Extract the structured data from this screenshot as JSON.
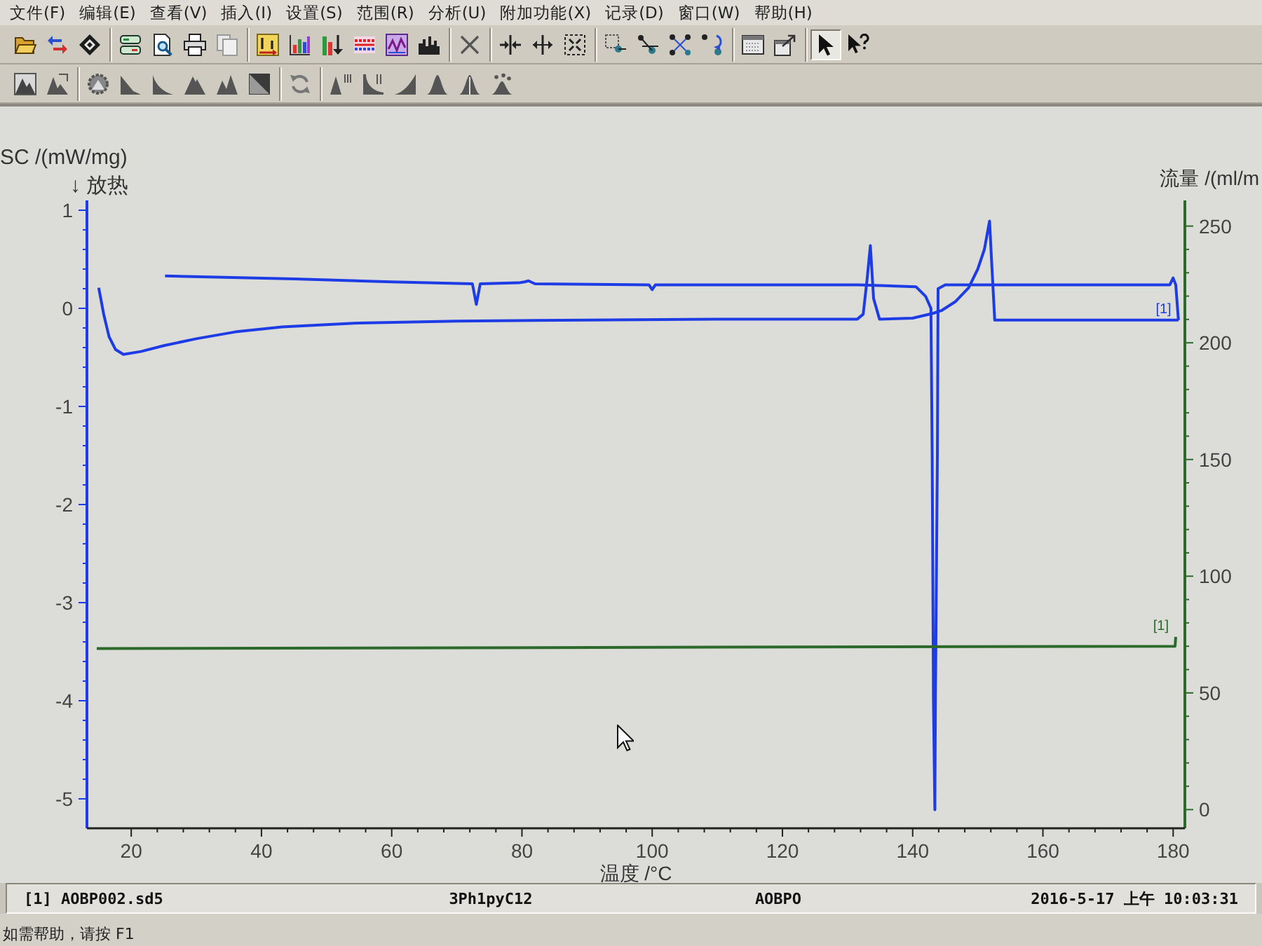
{
  "menu_bar": {
    "items": [
      "文件(F)",
      "编辑(E)",
      "查看(V)",
      "插入(I)",
      "设置(S)",
      "范围(R)",
      "分析(U)",
      "附加功能(X)",
      "记录(D)",
      "窗口(W)",
      "帮助(H)"
    ]
  },
  "toolbars": [
    {
      "groups": [
        [
          {
            "kind": "folder"
          },
          {
            "kind": "arrows"
          },
          {
            "kind": "diamond"
          }
        ],
        [
          {
            "kind": "panels"
          },
          {
            "kind": "preview"
          },
          {
            "kind": "printer"
          },
          {
            "kind": "pages"
          }
        ],
        [
          {
            "kind": "tile"
          },
          {
            "kind": "bars"
          },
          {
            "kind": "barsarrow"
          },
          {
            "kind": "lines"
          },
          {
            "kind": "wave"
          },
          {
            "kind": "skyline"
          }
        ],
        [
          {
            "kind": "cross"
          }
        ],
        [
          {
            "kind": "compress"
          },
          {
            "kind": "expand"
          },
          {
            "kind": "fit"
          }
        ],
        [
          {
            "kind": "pointbox"
          },
          {
            "kind": "points"
          },
          {
            "kind": "pointsfit"
          },
          {
            "kind": "pointsundo"
          }
        ],
        [
          {
            "kind": "window"
          },
          {
            "kind": "windowarrow"
          }
        ],
        [
          {
            "kind": "pointer",
            "selected": true
          },
          {
            "kind": "helppointer",
            "selected": false
          }
        ]
      ]
    },
    {
      "groups": [
        [
          {
            "kind": "peakbox"
          },
          {
            "kind": "peakarea"
          }
        ],
        [
          {
            "kind": "gearpeak"
          },
          {
            "kind": "slopepeak"
          },
          {
            "kind": "slope"
          },
          {
            "kind": "mountain"
          },
          {
            "kind": "doublepeak"
          },
          {
            "kind": "corner"
          }
        ],
        [
          {
            "kind": "refresh"
          }
        ],
        [
          {
            "kind": "peakmarks"
          },
          {
            "kind": "stepmarks"
          },
          {
            "kind": "ramp"
          },
          {
            "kind": "bell"
          },
          {
            "kind": "splitpeak"
          },
          {
            "kind": "dotspeak"
          }
        ]
      ]
    }
  ],
  "chart": {
    "chart_data": {
      "type": "line",
      "xlabel": "温度 /°C",
      "ylabel": "SC /(mW/mg)",
      "y2label": "流量 /(ml/m",
      "xlim": [
        13.2,
        181.8
      ],
      "ylim": [
        -5.3,
        1.1
      ],
      "y2lim": [
        -8,
        261
      ],
      "xticks": [
        20,
        40,
        60,
        80,
        100,
        120,
        140,
        160,
        180
      ],
      "yticks": [
        -5,
        -4,
        -3,
        -2,
        -1,
        0,
        1
      ],
      "y2ticks": [
        0,
        50,
        100,
        150,
        200,
        250
      ],
      "series": [
        {
          "name": "[1]",
          "color": "#1e3ce6",
          "x": [
            15.0,
            15.8,
            16.6,
            17.6,
            18.8,
            21.5,
            25,
            30,
            36,
            43.2,
            55,
            70,
            90,
            110,
            125,
            131.5,
            132.4,
            133.0,
            133.5,
            134.0,
            134.9,
            140,
            143.2,
            144.5,
            146.6,
            148.6,
            150.0,
            151.0,
            151.8,
            152.1,
            152.6,
            165,
            180.8
          ],
          "values": [
            0.21,
            -0.07,
            -0.29,
            -0.42,
            -0.47,
            -0.44,
            -0.38,
            -0.31,
            -0.24,
            -0.19,
            -0.15,
            -0.13,
            -0.12,
            -0.11,
            -0.11,
            -0.11,
            -0.06,
            0.3,
            0.64,
            0.1,
            -0.11,
            -0.1,
            -0.05,
            -0.02,
            0.07,
            0.21,
            0.4,
            0.6,
            0.89,
            0.5,
            -0.12,
            -0.12,
            -0.12
          ]
        },
        {
          "color": "#1e3ce6",
          "x": [
            180.8,
            180.4,
            180.0,
            179.5,
            170,
            155,
            145,
            143.9,
            143.8,
            143.5,
            143.4,
            143.2,
            143.0,
            142.8,
            142.0,
            140.5,
            131.6,
            110,
            100.5,
            100,
            99.5,
            82,
            81,
            80.4,
            79.5,
            73.6,
            73.0,
            72.4,
            60,
            45,
            25.2
          ],
          "values": [
            -0.12,
            0.24,
            0.31,
            0.24,
            0.24,
            0.24,
            0.24,
            0.2,
            -1.5,
            -4.0,
            -5.11,
            -4.0,
            -1.5,
            0.0,
            0.12,
            0.22,
            0.24,
            0.24,
            0.24,
            0.19,
            0.24,
            0.25,
            0.28,
            0.27,
            0.26,
            0.25,
            0.04,
            0.25,
            0.27,
            0.3,
            0.33
          ]
        },
        {
          "name": "[1]",
          "color": "#2b6a2b",
          "axis": "y2",
          "x": [
            14.7,
            100,
            180.3,
            180.4
          ],
          "values": [
            69,
            69.5,
            70,
            74
          ]
        }
      ],
      "annotations": [
        "↓ 放热"
      ]
    }
  },
  "status_bar": {
    "fields": [
      "[1] AOBP002.sd5",
      "3Ph1pyC12",
      "AOBPO",
      "2016-5-17 上午 10:03:31"
    ]
  },
  "help_hint": "如需帮助，请按 F1"
}
